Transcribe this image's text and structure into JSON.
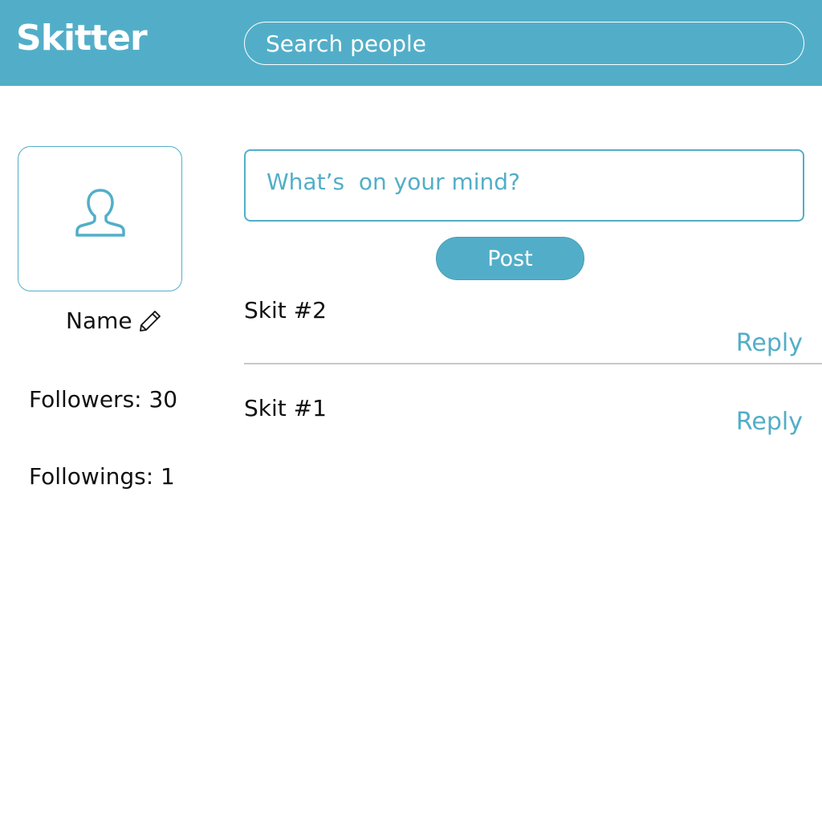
{
  "header": {
    "app_title": "Skitter",
    "search_placeholder": "Search people"
  },
  "profile": {
    "name": "Name",
    "followers_label": "Followers: 30",
    "followings_label": "Followings: 1",
    "avatar_icon": "user-icon",
    "edit_icon": "pencil-icon"
  },
  "composer": {
    "placeholder": "What’s  on your mind?",
    "post_label": "Post"
  },
  "feed": [
    {
      "text": "Skit #2",
      "reply_label": "Reply"
    },
    {
      "text": "Skit #1",
      "reply_label": "Reply"
    }
  ],
  "colors": {
    "accent": "#52aec8",
    "text": "#111111",
    "divider": "#c8c8c8"
  }
}
